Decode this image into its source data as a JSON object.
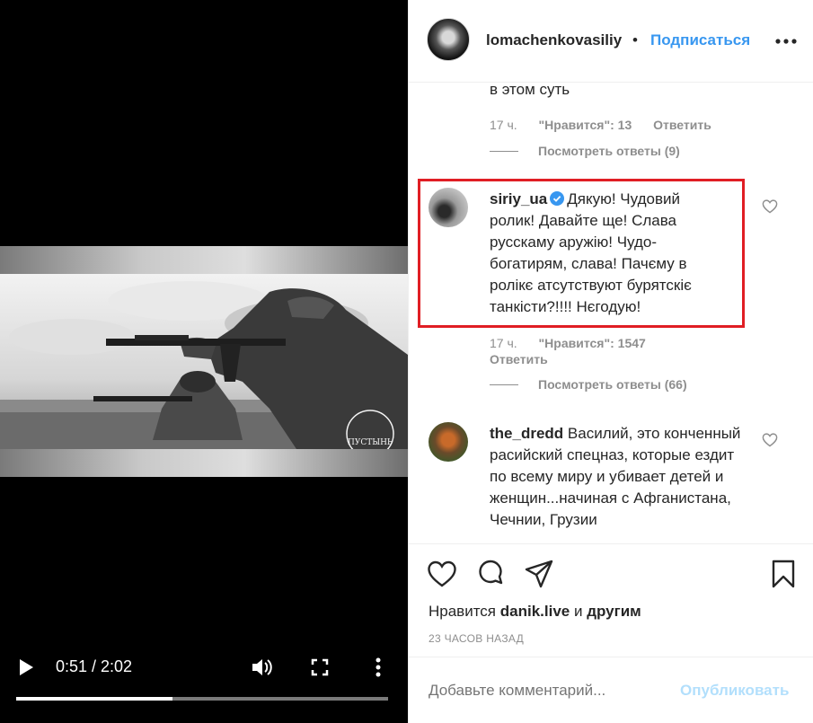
{
  "video": {
    "time": "0:51 / 2:02",
    "progress": 0.42,
    "watermark": "ПУСТЫНЬ"
  },
  "post": {
    "username": "lomachenkovasiliy",
    "separator": "•",
    "follow_label": "Подписаться"
  },
  "comments": [
    {
      "text_tail": "в этом суть",
      "time": "17 ч.",
      "likes": "\"Нравится\": 13",
      "reply_label": "Ответить",
      "view_replies": "Посмотреть ответы (9)"
    },
    {
      "username": "siriy_ua",
      "verified": true,
      "text": "Дякую! Чудовий ролик! Давайте ще! Слава русскаму аружію! Чудо-богатирям, слава! Пачєму в ролікє атсутствуют бурятскіє танкісти?!!!! Нєгодую!",
      "time": "17 ч.",
      "likes": "\"Нравится\": 1547",
      "reply_label": "Ответить",
      "view_replies": "Посмотреть ответы (66)"
    },
    {
      "username": "the_dredd",
      "text": "Василий, это конченный расийский спецназ, которые ездит по всему миру и убивает детей и женщин...начиная с Афганистана, Чечнии, Грузии"
    }
  ],
  "actions": {
    "icons": [
      "heart-icon",
      "comment-icon",
      "share-icon",
      "bookmark-icon"
    ],
    "likes_prefix": "Нравится",
    "likes_user": "danik.live",
    "likes_and": "и",
    "likes_others": "другим",
    "time_ago": "23 ЧАСОВ НАЗАД",
    "comment_placeholder": "Добавьте комментарий...",
    "publish_label": "Опубликовать"
  },
  "colors": {
    "accent": "#3897f0",
    "highlight": "#e01e24",
    "publish_disabled": "#b2dffc",
    "muted": "#8e8e8e"
  }
}
